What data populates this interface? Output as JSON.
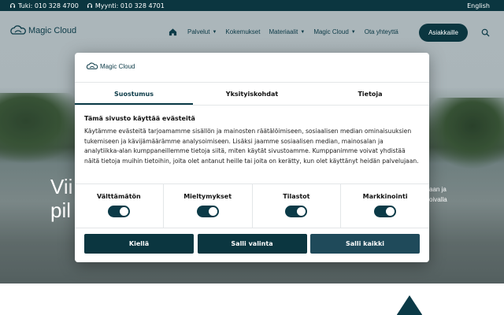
{
  "topbar": {
    "support": "Tuki: 010 328 4700",
    "sales": "Myynti: 010 328 4701",
    "language": "English"
  },
  "brand": {
    "name": "Magic Cloud"
  },
  "nav": {
    "items": [
      {
        "label": "Palvelut",
        "dropdown": true
      },
      {
        "label": "Kokemukset",
        "dropdown": false
      },
      {
        "label": "Materiaalit",
        "dropdown": true
      },
      {
        "label": "Magic Cloud",
        "dropdown": true
      },
      {
        "label": "Ota yhteyttä",
        "dropdown": false
      }
    ],
    "customer_button": "Asiakkaille"
  },
  "hero": {
    "title_line1": "Vii",
    "title_line2": "pil",
    "side_line1": "aan ja",
    "side_line2": "oivalla"
  },
  "consent": {
    "logo": "Magic Cloud",
    "tabs": [
      "Suostumus",
      "Yksityiskohdat",
      "Tietoja"
    ],
    "active_tab": "Suostumus",
    "heading": "Tämä sivusto käyttää evästeitä",
    "body": "Käytämme evästeitä tarjoamamme sisällön ja mainosten räätälöimiseen, sosiaalisen median ominaisuuksien tukemiseen ja kävijämäärämme analysoimiseen. Lisäksi jaamme sosiaalisen median, mainosalan ja analytiikka-alan kumppaneillemme tietoja siitä, miten käytät sivustoamme. Kumppanimme voivat yhdistää näitä tietoja muihin tietoihin, joita olet antanut heille tai joita on kerätty, kun olet käyttänyt heidän palvelujaan.",
    "toggles": [
      {
        "label": "Välttämätön",
        "on": true
      },
      {
        "label": "Mieltymykset",
        "on": true
      },
      {
        "label": "Tilastot",
        "on": true
      },
      {
        "label": "Markkinointi",
        "on": true
      }
    ],
    "buttons": {
      "deny": "Kiellä",
      "allow_selection": "Salli valinta",
      "allow_all": "Salli kaikki"
    }
  },
  "colors": {
    "primary": "#0b3640",
    "accent": "#1f4a5a",
    "text_dark": "#111111"
  },
  "icons": [
    "headset-icon",
    "home-icon",
    "chevron-down-icon",
    "search-icon",
    "cloud-logo-icon"
  ]
}
